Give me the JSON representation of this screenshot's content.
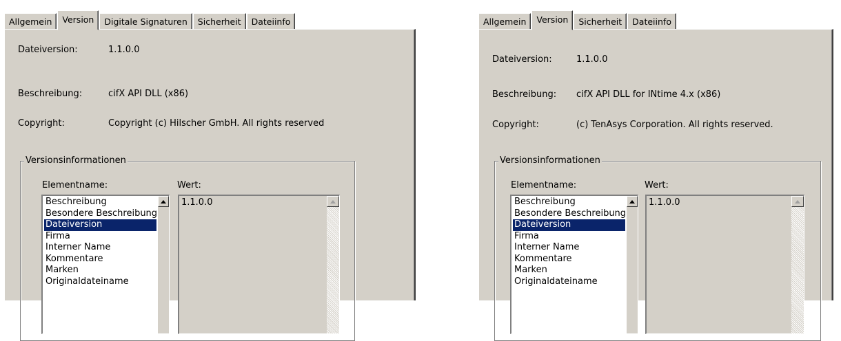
{
  "panel_left": {
    "tabs": [
      "Allgemein",
      "Version",
      "Digitale Signaturen",
      "Sicherheit",
      "Dateiinfo"
    ],
    "active_tab": "Version",
    "fields": {
      "dateiversion_label": "Dateiversion:",
      "dateiversion_value": "1.1.0.0",
      "beschreibung_label": "Beschreibung:",
      "beschreibung_value": "cifX API DLL (x86)",
      "copyright_label": "Copyright:",
      "copyright_value": "Copyright (c) Hilscher GmbH.  All rights reserved"
    },
    "group": {
      "legend": "Versionsinformationen",
      "elementname_label": "Elementname:",
      "wert_label": "Wert:",
      "items": [
        "Beschreibung",
        "Besondere Beschreibung",
        "Dateiversion",
        "Firma",
        "Interner Name",
        "Kommentare",
        "Marken",
        "Originaldateiname"
      ],
      "selected_item": "Dateiversion",
      "value": "1.1.0.0"
    }
  },
  "panel_right": {
    "tabs": [
      "Allgemein",
      "Version",
      "Sicherheit",
      "Dateiinfo"
    ],
    "active_tab": "Version",
    "fields": {
      "dateiversion_label": "Dateiversion:",
      "dateiversion_value": "1.1.0.0",
      "beschreibung_label": "Beschreibung:",
      "beschreibung_value": "cifX API DLL for INtime 4.x (x86)",
      "copyright_label": "Copyright:",
      "copyright_value": "(c) TenAsys Corporation.  All rights reserved."
    },
    "group": {
      "legend": "Versionsinformationen",
      "elementname_label": "Elementname:",
      "wert_label": "Wert:",
      "items": [
        "Beschreibung",
        "Besondere Beschreibung",
        "Dateiversion",
        "Firma",
        "Interner Name",
        "Kommentare",
        "Marken",
        "Originaldateiname"
      ],
      "selected_item": "Dateiversion",
      "value": "1.1.0.0"
    }
  },
  "colors": {
    "dialog_face": "#d4d0c8",
    "selection": "#0a246a"
  }
}
